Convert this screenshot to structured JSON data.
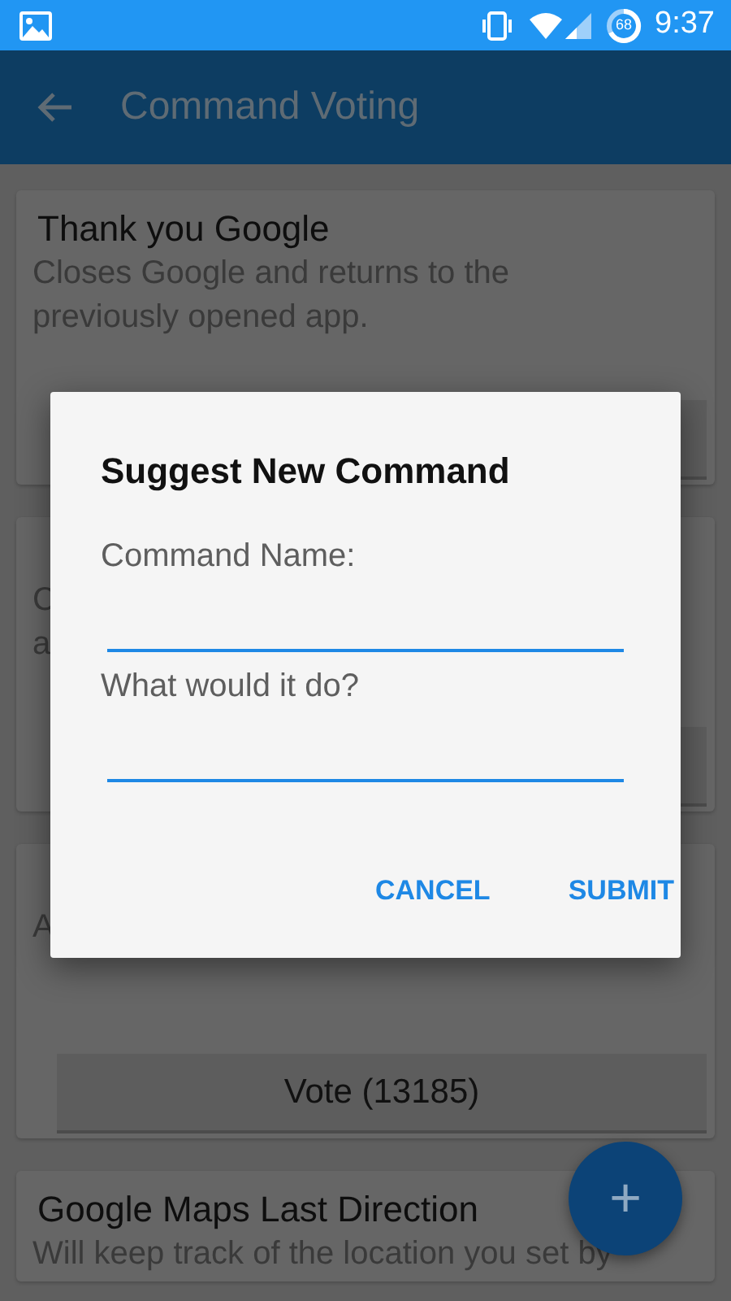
{
  "status_bar": {
    "battery": "68",
    "time": "9:37"
  },
  "app_bar": {
    "title": "Command Voting"
  },
  "cards": [
    {
      "title": "Thank you Google",
      "lines": [
        "Closes Google and returns to the",
        "previously opened app."
      ]
    },
    {
      "lines": [
        "C",
        "a"
      ]
    },
    {
      "lines": [
        "A"
      ],
      "vote_label": "Vote (13185)"
    },
    {
      "title": "Google Maps Last Direction",
      "lines": [
        "Will keep track of the location you set by"
      ]
    }
  ],
  "dialog": {
    "title": "Suggest New Command",
    "fields": [
      {
        "label": "Command Name:"
      },
      {
        "label": "What would it do?"
      }
    ],
    "buttons": [
      "CANCEL",
      "SUBMIT"
    ]
  },
  "fab": {
    "label": "+"
  }
}
